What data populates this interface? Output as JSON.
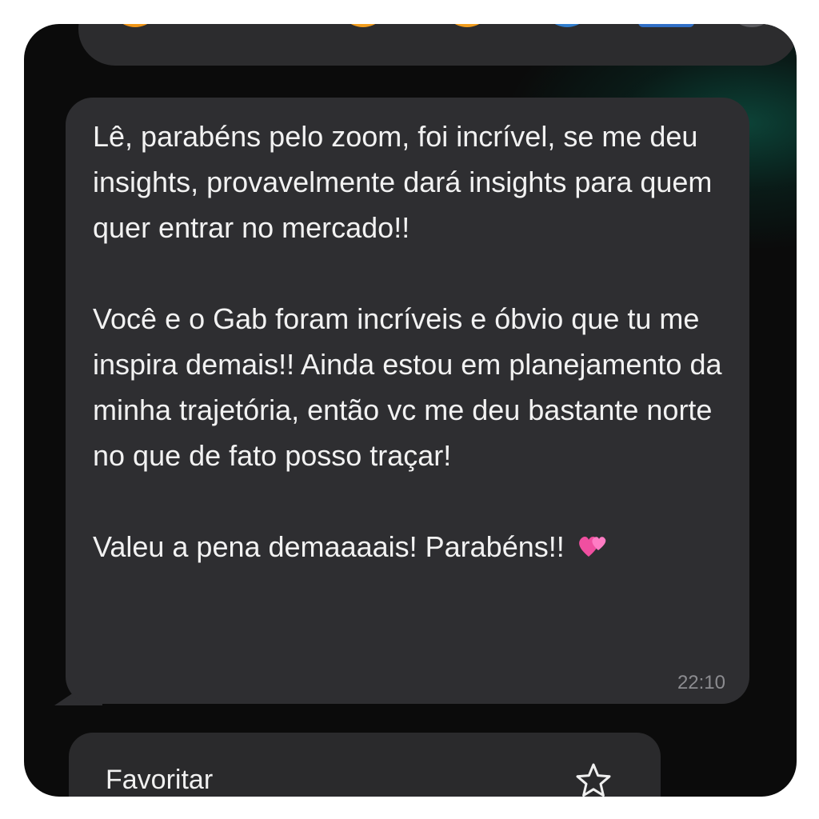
{
  "reactions": {
    "emojis": [
      "smiling-hands-face",
      "heart",
      "face-with-tears-of-joy",
      "astonished-face",
      "crying-face",
      "folded-hands"
    ],
    "more_icon": "plus-circle-icon"
  },
  "message": {
    "paragraphs": [
      "Lê, parabéns pelo zoom, foi incrível, se me deu insights, provavelmente dará insights para quem quer entrar no mercado!!",
      "Você e o Gab foram incríveis e óbvio que tu me inspira demais!! Ainda estou em planejamento da minha trajetória, então vc me deu bastante norte no que de fato posso traçar!",
      "Valeu a pena demaaaais! Parabéns!!"
    ],
    "emoji": "two-hearts",
    "time": "22:10"
  },
  "context_menu": {
    "items": [
      {
        "label": "Favoritar",
        "icon": "star-icon"
      }
    ]
  },
  "colors": {
    "bubble": "#2e2e31",
    "background": "#0b0b0b",
    "text": "#f2f2f2",
    "timestamp": "#8c8c90",
    "accent_glow": "#0c463a"
  }
}
